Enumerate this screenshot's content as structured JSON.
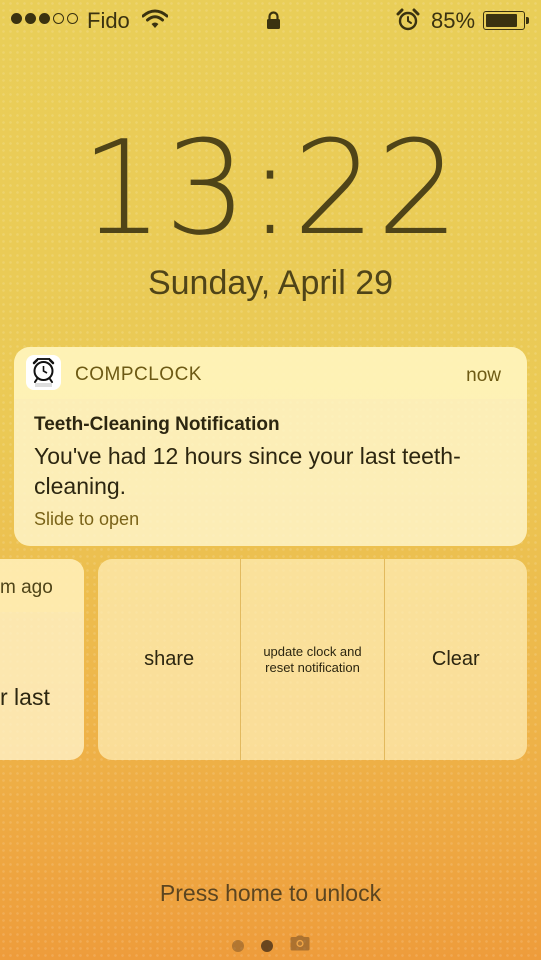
{
  "status_bar": {
    "carrier": "Fido",
    "signal_bars_filled": 3,
    "signal_bars_total": 5,
    "battery_percent": "85%",
    "battery_level": 0.85
  },
  "lock_screen": {
    "time": "13:22",
    "date": "Sunday, April 29",
    "unlock_hint": "Press home to unlock",
    "page_count": 3,
    "active_page": 2
  },
  "notification": {
    "app_name": "COMPCLOCK",
    "time": "now",
    "title": "Teeth-Cleaning Notification",
    "body": "You've had 12 hours since your last teeth-cleaning.",
    "hint": "Slide to open"
  },
  "swiped_notification": {
    "time_fragment": "m ago",
    "body_fragment": "r last"
  },
  "actions": {
    "share": "share",
    "update": "update clock and reset notification",
    "clear": "Clear"
  },
  "icons": {
    "wifi": "wifi-icon",
    "lock": "lock-icon",
    "alarm": "alarm-clock-icon",
    "battery": "battery-icon",
    "app": "compclock-app-icon",
    "camera": "camera-icon"
  }
}
